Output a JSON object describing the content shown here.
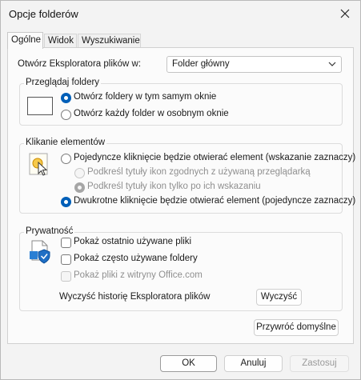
{
  "window": {
    "title": "Opcje folderów"
  },
  "tabs": [
    "Ogólne",
    "Widok",
    "Wyszukiwanie"
  ],
  "general": {
    "open_explorer_label": "Otwórz Eksploratora plików w:",
    "open_explorer_value": "Folder główny",
    "browse": {
      "title": "Przeglądaj foldery",
      "option1": "Otwórz foldery w tym samym oknie",
      "option2": "Otwórz każdy folder w osobnym oknie"
    },
    "click": {
      "title": "Klikanie elementów",
      "single": "Pojedyncze kliknięcie będzie otwierać element (wskazanie zaznaczy)",
      "sub1": "Podkreśl tytuły ikon zgodnych z używaną przeglądarką",
      "sub2": "Podkreśl tytuły ikon tylko po ich wskazaniu",
      "double": "Dwukrotne kliknięcie będzie otwierać element (pojedyncze zaznaczy)"
    },
    "privacy": {
      "title": "Prywatność",
      "recent_files": "Pokaż ostatnio używane pliki",
      "frequent_folders": "Pokaż często używane foldery",
      "office_files": "Pokaż pliki z witryny Office.com",
      "clear_history_label": "Wyczyść historię Eksploratora plików",
      "clear_button": "Wyczyść"
    },
    "restore_defaults": "Przywróć domyślne"
  },
  "footer": {
    "ok": "OK",
    "cancel": "Anuluj",
    "apply": "Zastosuj"
  },
  "colors": {
    "accent": "#005fb8"
  },
  "icons": [
    "close-icon",
    "chevron-down-icon",
    "window-icon",
    "click-cursor-icon",
    "privacy-document-icon"
  ]
}
